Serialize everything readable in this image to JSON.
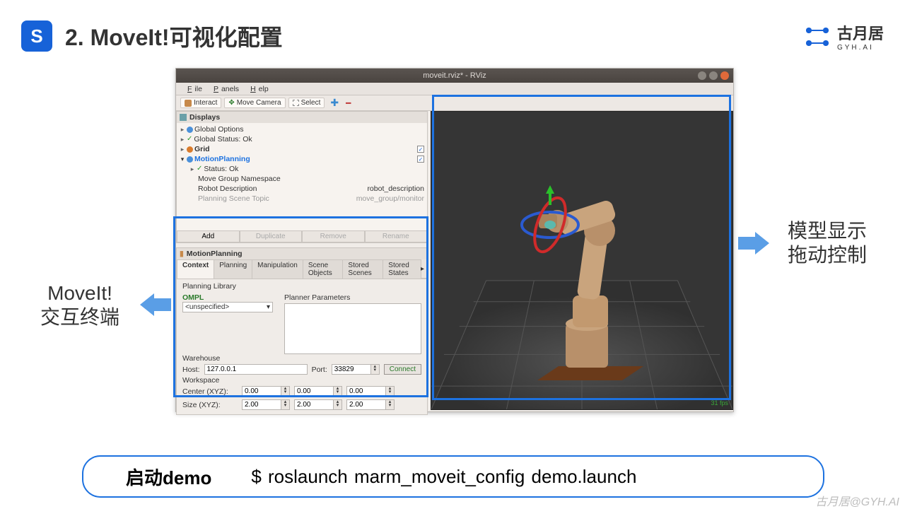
{
  "slide": {
    "icon_letter": "S",
    "title": "2. MoveIt!可视化配置"
  },
  "logo": {
    "main": "古月居",
    "sub": "GYH.AI"
  },
  "window": {
    "title": "moveit.rviz* - RViz",
    "menus": [
      "File",
      "Panels",
      "Help"
    ],
    "toolbar": {
      "interact": "Interact",
      "move_camera": "Move Camera",
      "select": "Select"
    }
  },
  "displays": {
    "header": "Displays",
    "items": [
      {
        "label": "Global Options",
        "exp": "▸",
        "color": "#4a90d9"
      },
      {
        "label": "Global Status: Ok",
        "exp": "▸",
        "check": true
      },
      {
        "label": "Grid",
        "exp": "▸",
        "color": "#d97b2c",
        "checkbox": "✓"
      },
      {
        "label": "MotionPlanning",
        "exp": "▾",
        "color": "#4a90d9",
        "bold": true,
        "checkbox": "✓"
      },
      {
        "label": "Status: Ok",
        "exp": "▸",
        "check": true,
        "indent": true
      },
      {
        "label": "Move Group Namespace",
        "indent": true
      },
      {
        "label": "Robot Description",
        "value": "robot_description",
        "indent": true
      },
      {
        "label": "Planning Scene Topic",
        "value": "move_group/monitor",
        "indent": true,
        "faded": true
      }
    ],
    "buttons": {
      "add": "Add",
      "duplicate": "Duplicate",
      "remove": "Remove",
      "rename": "Rename"
    }
  },
  "mp": {
    "header": "MotionPlanning",
    "tabs": [
      "Context",
      "Planning",
      "Manipulation",
      "Scene Objects",
      "Stored Scenes",
      "Stored States"
    ],
    "active_tab": 0,
    "library_label": "Planning Library",
    "ompl": "OMPL",
    "planner_params": "Planner Parameters",
    "planner_value": "<unspecified>",
    "warehouse": {
      "label": "Warehouse",
      "host_label": "Host:",
      "host": "127.0.0.1",
      "port_label": "Port:",
      "port": "33829",
      "connect": "Connect"
    },
    "workspace": {
      "label": "Workspace",
      "center_label": "Center (XYZ):",
      "center": [
        "0.00",
        "0.00",
        "0.00"
      ],
      "size_label": "Size (XYZ):",
      "size": [
        "2.00",
        "2.00",
        "2.00"
      ]
    }
  },
  "viewport": {
    "fps": "31 fps"
  },
  "callouts": {
    "left_l1": "MoveIt!",
    "left_l2": "交互终端",
    "right_l1": "模型显示",
    "right_l2": "拖动控制"
  },
  "command": {
    "label": "启动demo",
    "text": "$ roslaunch marm_moveit_config demo.launch"
  },
  "watermark": "古月居@GYH.AI"
}
